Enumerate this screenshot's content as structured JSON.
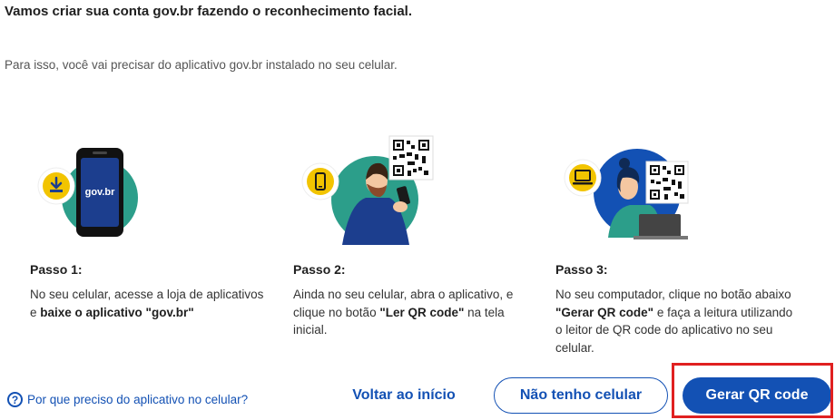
{
  "heading": "Vamos criar sua conta gov.br fazendo o reconhecimento facial.",
  "intro": "Para isso, você vai precisar do aplicativo gov.br instalado no seu celular.",
  "steps": [
    {
      "title": "Passo 1:",
      "text_parts": [
        "No seu celular, acesse a loja de aplicativos e ",
        "baixe o aplicativo \"gov.br\""
      ],
      "phone_logo": "gov.br",
      "icon": "download-icon"
    },
    {
      "title": "Passo 2:",
      "text_parts": [
        "Ainda no seu celular, abra o aplicativo, e clique no botão ",
        "\"Ler QR code\"",
        " na tela inicial."
      ],
      "icon": "mobile-phone-icon"
    },
    {
      "title": "Passo 3:",
      "text_parts": [
        "No seu computador, clique no botão abaixo ",
        "\"Gerar QR code\"",
        " e faça a leitura utilizando o leitor de QR code do aplicativo no seu celular."
      ],
      "icon": "laptop-icon"
    }
  ],
  "help": {
    "icon": "question-circle-icon",
    "label": "Por que preciso do aplicativo no celular?"
  },
  "buttons": {
    "back": "Voltar ao início",
    "no_phone": "Não tenho celular",
    "generate": "Gerar QR code"
  },
  "colors": {
    "primary": "#1351b4",
    "teal": "#2c9e8a",
    "yellow": "#f2c400",
    "highlight": "#e02020"
  }
}
